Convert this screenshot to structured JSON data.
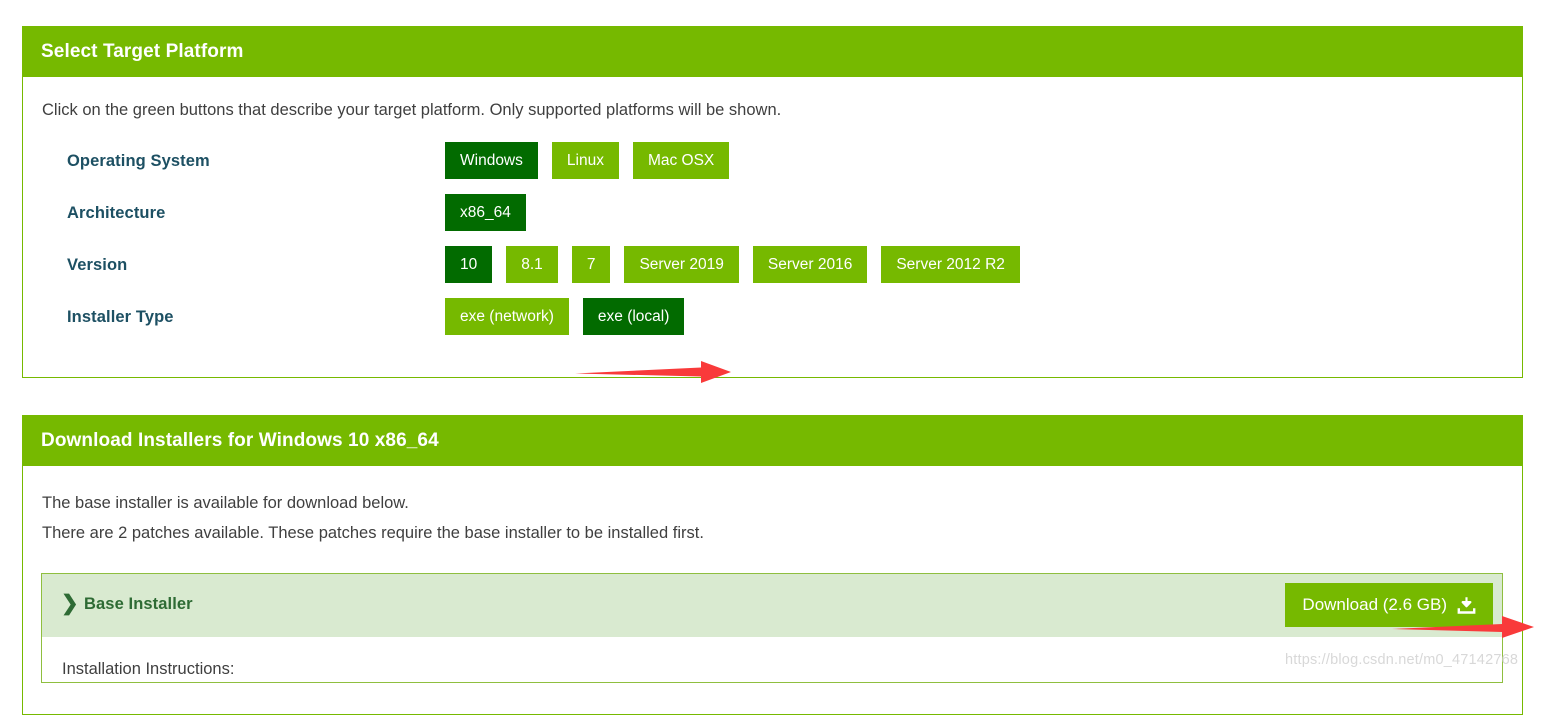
{
  "colors": {
    "brand_green": "#76b900",
    "selected_green": "#026b00",
    "label_blue": "#1d5063",
    "accordion_bg": "#d9ead0",
    "accordion_text": "#2e6b34",
    "arrow_red": "#f93a3a",
    "watermark_grey": "#d8d8d8"
  },
  "select_panel": {
    "header": "Select Target Platform",
    "intro": "Click on the green buttons that describe your target platform. Only supported platforms will be shown.",
    "rows": [
      {
        "label": "Operating System",
        "options": [
          {
            "label": "Windows",
            "selected": true
          },
          {
            "label": "Linux",
            "selected": false
          },
          {
            "label": "Mac OSX",
            "selected": false
          }
        ]
      },
      {
        "label": "Architecture",
        "options": [
          {
            "label": "x86_64",
            "selected": true
          }
        ]
      },
      {
        "label": "Version",
        "options": [
          {
            "label": "10",
            "selected": true
          },
          {
            "label": "8.1",
            "selected": false
          },
          {
            "label": "7",
            "selected": false
          },
          {
            "label": "Server 2019",
            "selected": false
          },
          {
            "label": "Server 2016",
            "selected": false
          },
          {
            "label": "Server 2012 R2",
            "selected": false
          }
        ]
      },
      {
        "label": "Installer Type",
        "options": [
          {
            "label": "exe (network)",
            "selected": false
          },
          {
            "label": "exe (local)",
            "selected": true
          }
        ]
      }
    ]
  },
  "download_panel": {
    "header": "Download Installers for Windows 10 x86_64",
    "line1": "The base installer is available for download below.",
    "line2": "There are 2 patches available. These patches require the base installer to be installed first.",
    "installer": {
      "chevron": "❯",
      "title": "Base Installer",
      "download_label": "Download (2.6 GB)",
      "download_icon": "download-tray-icon",
      "instructions": "Installation Instructions:"
    }
  },
  "annotations": {
    "arrow_installer_type": "red-arrow-right-icon",
    "arrow_download_button": "red-arrow-right-icon"
  },
  "watermark": "https://blog.csdn.net/m0_47142768"
}
